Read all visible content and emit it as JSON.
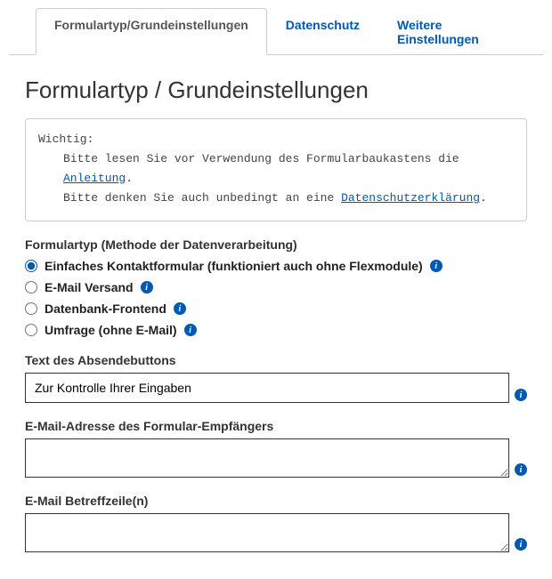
{
  "tabs": [
    {
      "label": "Formulartyp/Grundeinstellungen",
      "active": true
    },
    {
      "label": "Datenschutz",
      "active": false
    },
    {
      "label": "Weitere Einstellungen",
      "active": false
    }
  ],
  "page_title": "Formulartyp / Grundeinstellungen",
  "notice": {
    "label": "Wichtig:",
    "line1_pre": "Bitte lesen Sie vor Verwendung des Formularbaukastens die ",
    "line1_link": "Anleitung",
    "line1_post": ".",
    "line2_pre": "Bitte denken Sie auch unbedingt an eine ",
    "line2_link": "Datenschutzerklärung",
    "line2_post": "."
  },
  "formtype": {
    "legend": "Formulartyp (Methode der Datenverarbeitung)",
    "options": [
      {
        "label": "Einfaches Kontaktformular (funktioniert auch ohne Flexmodule)",
        "checked": true
      },
      {
        "label": "E-Mail Versand",
        "checked": false
      },
      {
        "label": "Datenbank-Frontend",
        "checked": false
      },
      {
        "label": "Umfrage (ohne E-Mail)",
        "checked": false
      }
    ]
  },
  "fields": {
    "submit_text": {
      "label": "Text des Absendebuttons",
      "value": "Zur Kontrolle Ihrer Eingaben"
    },
    "recipient_email": {
      "label": "E-Mail-Adresse des Formular-Empfängers",
      "value": ""
    },
    "subject_lines": {
      "label": "E-Mail Betreffzeile(n)",
      "value": ""
    }
  }
}
